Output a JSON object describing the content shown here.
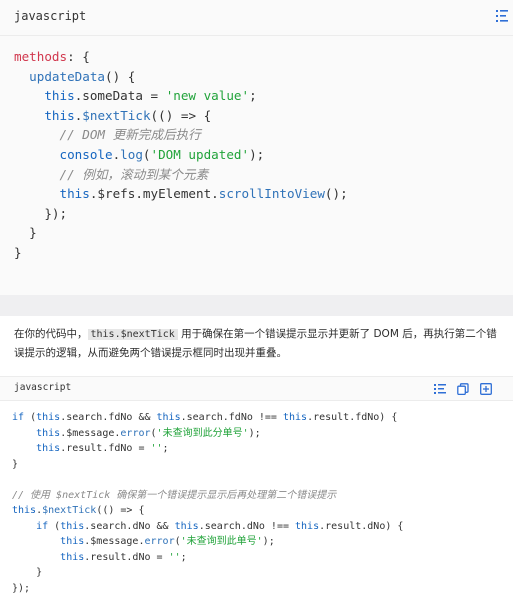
{
  "block1": {
    "language": "javascript",
    "lines": [
      [
        [
          "methods",
          "mth"
        ],
        [
          ": {",
          "pl"
        ]
      ],
      [
        [
          "  ",
          "pl"
        ],
        [
          "updateData",
          "fn"
        ],
        [
          "() {",
          "pl"
        ]
      ],
      [
        [
          "    ",
          "pl"
        ],
        [
          "this",
          "k"
        ],
        [
          ".someData = ",
          "pl"
        ],
        [
          "'new value'",
          "str"
        ],
        [
          ";",
          "pl"
        ]
      ],
      [
        [
          "    ",
          "pl"
        ],
        [
          "this",
          "k"
        ],
        [
          ".",
          "pl"
        ],
        [
          "$nextTick",
          "fn"
        ],
        [
          "(() => {",
          "pl"
        ]
      ],
      [
        [
          "      ",
          "pl"
        ],
        [
          "// DOM 更新完成后执行",
          "cm"
        ]
      ],
      [
        [
          "      ",
          "pl"
        ],
        [
          "console",
          "k"
        ],
        [
          ".",
          "pl"
        ],
        [
          "log",
          "fn"
        ],
        [
          "(",
          "pl"
        ],
        [
          "'DOM updated'",
          "str"
        ],
        [
          ");",
          "pl"
        ]
      ],
      [
        [
          "      ",
          "pl"
        ],
        [
          "// 例如，滚动到某个元素",
          "cm"
        ]
      ],
      [
        [
          "      ",
          "pl"
        ],
        [
          "this",
          "k"
        ],
        [
          ".$refs.myElement.",
          "pl"
        ],
        [
          "scrollIntoView",
          "fn"
        ],
        [
          "();",
          "pl"
        ]
      ],
      [
        [
          "    });",
          "pl"
        ]
      ],
      [
        [
          "  }",
          "pl"
        ]
      ],
      [
        [
          "}",
          "pl"
        ]
      ]
    ]
  },
  "paragraph": {
    "before": "在你的代码中，",
    "code": "this.$nextTick",
    "after": " 用于确保在第一个错误提示显示并更新了 DOM 后，再执行第二个错误提示的逻辑，从而避免两个错误提示框同时出现并重叠。"
  },
  "block2": {
    "language": "javascript",
    "lines": [
      [
        [
          "if",
          "k"
        ],
        [
          " (",
          "pl"
        ],
        [
          "this",
          "k"
        ],
        [
          ".search.fdNo && ",
          "pl"
        ],
        [
          "this",
          "k"
        ],
        [
          ".search.fdNo !== ",
          "pl"
        ],
        [
          "this",
          "k"
        ],
        [
          ".result.fdNo) {",
          "pl"
        ]
      ],
      [
        [
          "    ",
          "pl"
        ],
        [
          "this",
          "k"
        ],
        [
          ".$message.",
          "pl"
        ],
        [
          "error",
          "fn"
        ],
        [
          "(",
          "pl"
        ],
        [
          "'未查询到此分单号'",
          "str"
        ],
        [
          ");",
          "pl"
        ]
      ],
      [
        [
          "    ",
          "pl"
        ],
        [
          "this",
          "k"
        ],
        [
          ".result.fdNo = ",
          "pl"
        ],
        [
          "''",
          "str"
        ],
        [
          ";",
          "pl"
        ]
      ],
      [
        [
          "}",
          "pl"
        ]
      ],
      [
        [
          "",
          "pl"
        ]
      ],
      [
        [
          "// 使用 $nextTick 确保第一个错误提示显示后再处理第二个错误提示",
          "cm"
        ]
      ],
      [
        [
          "this",
          "k"
        ],
        [
          ".",
          "pl"
        ],
        [
          "$nextTick",
          "fn"
        ],
        [
          "(() => {",
          "pl"
        ]
      ],
      [
        [
          "    ",
          "pl"
        ],
        [
          "if",
          "k"
        ],
        [
          " (",
          "pl"
        ],
        [
          "this",
          "k"
        ],
        [
          ".search.dNo && ",
          "pl"
        ],
        [
          "this",
          "k"
        ],
        [
          ".search.dNo !== ",
          "pl"
        ],
        [
          "this",
          "k"
        ],
        [
          ".result.dNo) {",
          "pl"
        ]
      ],
      [
        [
          "        ",
          "pl"
        ],
        [
          "this",
          "k"
        ],
        [
          ".$message.",
          "pl"
        ],
        [
          "error",
          "fn"
        ],
        [
          "(",
          "pl"
        ],
        [
          "'未查询到此单号'",
          "str"
        ],
        [
          ");",
          "pl"
        ]
      ],
      [
        [
          "        ",
          "pl"
        ],
        [
          "this",
          "k"
        ],
        [
          ".result.dNo = ",
          "pl"
        ],
        [
          "''",
          "str"
        ],
        [
          ";",
          "pl"
        ]
      ],
      [
        [
          "    }",
          "pl"
        ]
      ],
      [
        [
          "});",
          "pl"
        ]
      ]
    ]
  },
  "icons": {
    "wrap": "wrap-lines-icon",
    "copy": "copy-icon",
    "expand": "expand-icon"
  },
  "colors": {
    "keyword": "#1565c0",
    "function": "#2f72b8",
    "string": "#21a33a",
    "comment": "#8a8a8a",
    "accent": "#2f6fd6"
  }
}
